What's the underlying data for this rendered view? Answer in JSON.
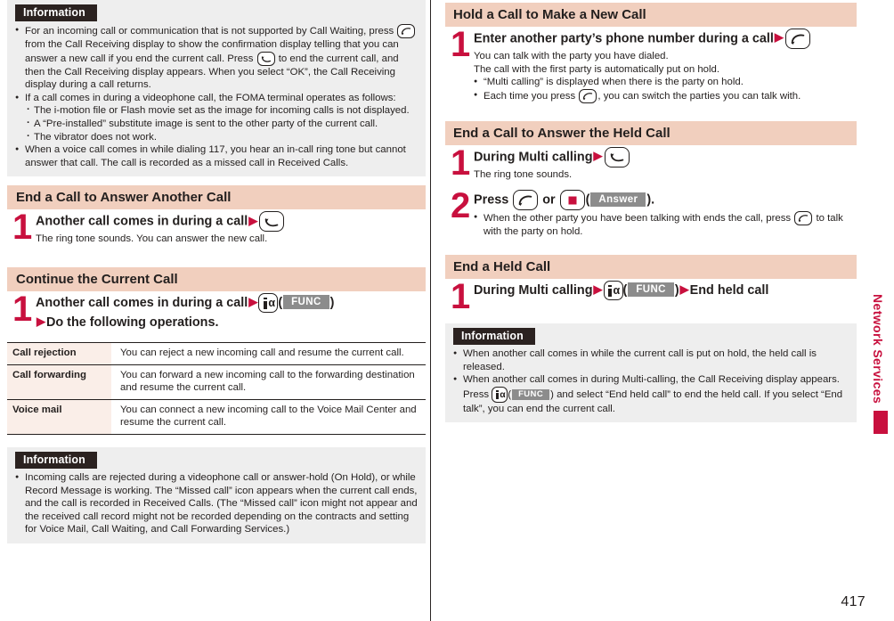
{
  "page_number": "417",
  "side_tab": {
    "label": "Network Services"
  },
  "left_column": {
    "info_top": {
      "tag": "Information",
      "bullets": [
        {
          "parts_before": "For an incoming call or communication that is not supported by Call Waiting, press",
          "icon1": "call-key-icon",
          "parts_mid": "from the Call Receiving display to show the confirmation display telling that you can answer a new call if you end the current call. Press",
          "icon2": "end-call-key-icon",
          "parts_after": "to end the current call, and then the Call Receiving display appears. When you select “OK”, the Call Receiving display during a call returns."
        },
        {
          "text": "If a call comes in during a videophone call, the FOMA terminal operates as follows:",
          "sub": [
            "The i-motion file or Flash movie set as the image for incoming calls is not displayed.",
            "A “Pre-installed” substitute image is sent to the other party of the current call.",
            "The vibrator does not work."
          ]
        },
        {
          "text": "When a voice call comes in while dialing 117, you hear an in-call ring tone but cannot answer that call. The call is recorded as a missed call in Received Calls."
        }
      ]
    },
    "section_end_answer_another": {
      "heading": "End a Call to Answer Another Call",
      "step_number": "1",
      "step_title": "Another call comes in during a call",
      "step_key": "end-call-key-icon",
      "step_body": "The ring tone sounds. You can answer the new call."
    },
    "section_continue_current": {
      "heading": "Continue the Current Call",
      "step_number": "1",
      "step_title_line1": "Another call comes in during a call",
      "step_key": "i-alpha-key-icon",
      "step_softkey": "FUNC",
      "step_title_line2": "Do the following operations.",
      "table": {
        "rows": [
          {
            "key": "Call rejection",
            "value": "You can reject a new incoming call and resume the current call."
          },
          {
            "key": "Call forwarding",
            "value": "You can forward a new incoming call to the forwarding destination and resume the current call."
          },
          {
            "key": "Voice mail",
            "value": "You can connect a new incoming call to the Voice Mail Center and resume the current call."
          }
        ]
      }
    },
    "info_bottom": {
      "tag": "Information",
      "bullets": [
        "Incoming calls are rejected during a videophone call or answer-hold (On Hold), or while Record Message is working. The “Missed call” icon appears when the current call ends, and the call is recorded in Received Calls. (The “Missed call” icon might not appear and the received call record might not be recorded depending on the contracts and setting for Voice Mail, Call Waiting, and Call Forwarding Services.)"
      ]
    }
  },
  "right_column": {
    "section_hold_call": {
      "heading": "Hold a Call to Make a New Call",
      "step_number": "1",
      "step_title": "Enter another party’s phone number during a call",
      "step_key": "call-key-icon",
      "body_lines": [
        "You can talk with the party you have dialed.",
        "The call with the first party is automatically put on hold."
      ],
      "bullets": [
        {
          "text": "“Multi calling” is displayed when there is the party on hold."
        },
        {
          "text_before": "Each time you press",
          "icon": "call-key-icon",
          "text_after": ", you can switch the parties you can talk with."
        }
      ]
    },
    "section_end_call_held": {
      "heading": "End a Call to Answer the Held Call",
      "steps": [
        {
          "number": "1",
          "title": "During Multi calling",
          "key": "end-call-key-icon",
          "body": "The ring tone sounds."
        },
        {
          "number": "2",
          "title_before": "Press",
          "key1": "call-key-icon",
          "title_mid": "or",
          "key2": "center-select-key-icon",
          "softkey": "Answer",
          "title_after": ".",
          "bullet_before": "When the other party you have been talking with ends the call, press",
          "bullet_key": "call-key-icon",
          "bullet_after": "to talk with the party on hold."
        }
      ]
    },
    "section_end_held_call": {
      "heading": "End a Held Call",
      "step_number": "1",
      "step_title_before": "During Multi calling",
      "step_key": "i-alpha-key-icon",
      "step_softkey": "FUNC",
      "step_title_after": "End held call"
    },
    "info": {
      "tag": "Information",
      "bullets": [
        {
          "text": "When another call comes in while the current call is put on hold, the held call is released."
        },
        {
          "text_before": "When another call comes in during Multi-calling, the Call Receiving display appears. Press",
          "icon": "i-alpha-key-icon",
          "softkey": "FUNC",
          "text_after": "and select “End held call” to end the held call. If you select “End talk”, you can end the current call."
        }
      ]
    }
  },
  "colors": {
    "accent_red": "#c8103e",
    "section_header_bg": "#f1cfbe",
    "info_bg": "#eeeeee",
    "info_tag_bg": "#2b2220",
    "table_key_bg": "#faeee8",
    "softkey_bg": "#8c8c8c"
  }
}
